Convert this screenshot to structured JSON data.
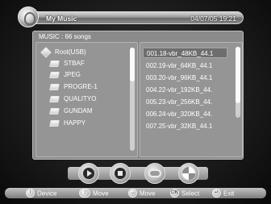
{
  "header": {
    "app_title": "My Music",
    "datetime": "04/07/05 19:21"
  },
  "panel": {
    "header_text": "MUSIC : 66 songs"
  },
  "folders": [
    {
      "label": "Root(USB)"
    },
    {
      "label": "STBAF"
    },
    {
      "label": "JPEG"
    },
    {
      "label": "PROGRE-1"
    },
    {
      "label": "QUALITYO"
    },
    {
      "label": "GUNDAM"
    },
    {
      "label": "HAPPY"
    }
  ],
  "files": [
    {
      "label": "001.18-vbr_48KB_44.1",
      "selected": true
    },
    {
      "label": "002.19-vbr_64KB_44.1"
    },
    {
      "label": "003.20-vbr_96KB_44.1"
    },
    {
      "label": "004.22-vbr_192KB_44."
    },
    {
      "label": "005.23-vbr_256KB_44."
    },
    {
      "label": "006.24-vbr_320KB_44."
    },
    {
      "label": "007.25-vbr_32KB_44.1"
    }
  ],
  "controls": {
    "icons": [
      "play-icon",
      "stop-icon",
      "repeat-icon",
      "equalizer-icon"
    ]
  },
  "helpbar": {
    "device": {
      "key": "i",
      "label": "Device"
    },
    "move_updown": {
      "key": "↕",
      "label": "Move"
    },
    "move_leftright": {
      "key": "↔",
      "label": "Move"
    },
    "select": {
      "key": "OK",
      "label": "Select"
    },
    "exit": {
      "key": "↵",
      "label": "Exit"
    }
  },
  "colors": {
    "panel_bg": "#8a8a8a",
    "selected_row": "#6e6e6e",
    "screen_bg": "#1c1c1c"
  }
}
